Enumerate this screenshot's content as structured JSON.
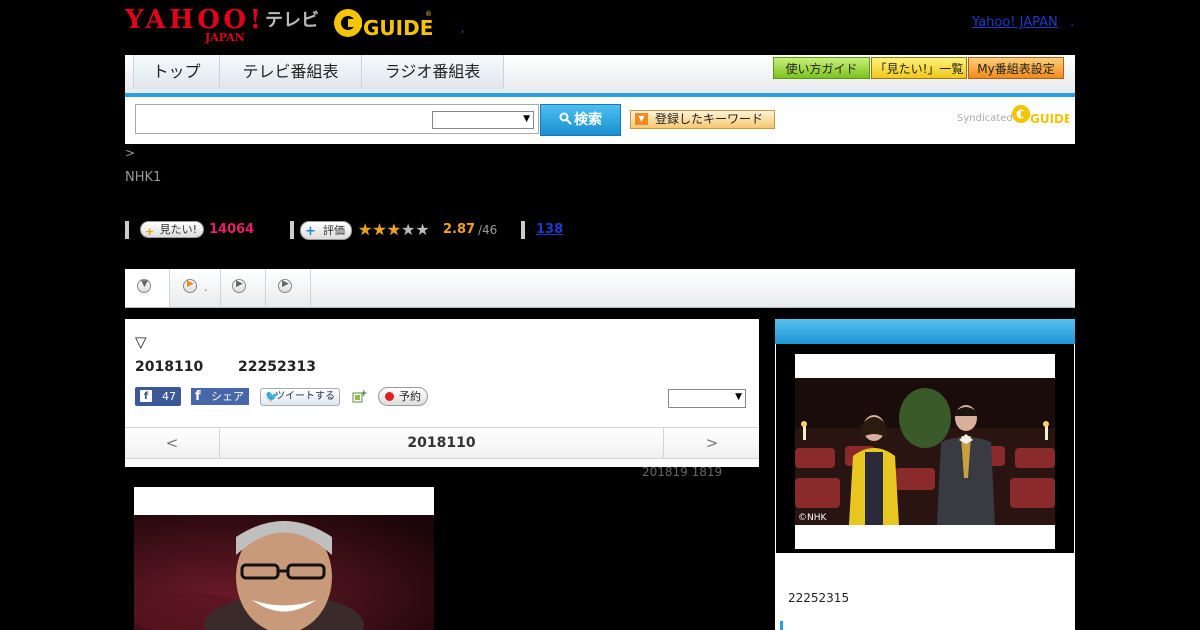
{
  "header": {
    "yahoo_logo": "YAHOO! JAPAN",
    "terebi": "テレビ",
    "gguide_logo": "G-GUIDE",
    "top_link": "Yahoo! JAPAN",
    "top_dot": ".",
    "tick": ","
  },
  "nav": {
    "tabs": [
      "トップ",
      "テレビ番組表",
      "ラジオ番組表"
    ],
    "buttons": [
      "使い方ガイド",
      "「見たい!」一覧",
      "My番組表設定"
    ]
  },
  "search": {
    "input_value": "",
    "select_value": "",
    "search_label": "検索",
    "keyword_label": "登録したキーワード",
    "syndicated": "Syndicated",
    "synd_logo": "G-GUIDE"
  },
  "breadcrumb": ">",
  "channel": "NHK1",
  "stats": {
    "mitai_label": "見たい!",
    "mitai_count": "14064",
    "eval_label": "評価",
    "rating": 2.87,
    "score": "2.87",
    "score_den": "/46",
    "review_count": "138"
  },
  "program_tabs": [
    {
      "icon": "chevron-down-icon",
      "label": ""
    },
    {
      "icon": "play-icon",
      "label": "."
    },
    {
      "icon": "play-icon",
      "label": ""
    },
    {
      "icon": "play-icon",
      "label": ""
    }
  ],
  "program": {
    "title_symbol": "▽",
    "date": "2018110",
    "time": "22252313",
    "fb_count": "47",
    "fb_share": "シェア",
    "tweet": "ツイートする",
    "record": "予約",
    "record_select": ""
  },
  "day_nav": {
    "prev": "<",
    "current": "2018110",
    "next": ">"
  },
  "updated": "201819  1819",
  "right_panel": {
    "time": "22252315",
    "video_credit": "©NHK"
  },
  "colors": {
    "accent_blue": "#2aa0dc",
    "pink": "#e0206c",
    "star_orange": "#f0a020",
    "link_blue": "#1a3cc8"
  }
}
